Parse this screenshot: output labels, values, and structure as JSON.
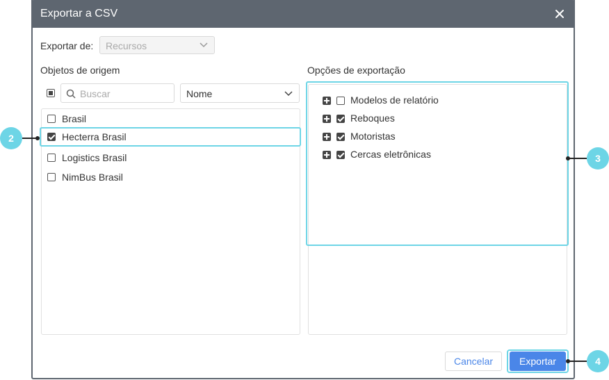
{
  "dialog": {
    "title": "Exportar a CSV",
    "export_from_label": "Exportar de:",
    "export_from_value": "Recursos"
  },
  "source": {
    "title": "Objetos de origem",
    "search_placeholder": "Buscar",
    "sort_value": "Nome",
    "items": [
      {
        "label": "Brasil",
        "checked": false
      },
      {
        "label": "Hecterra Brasil",
        "checked": true
      },
      {
        "label": "Logistics Brasil",
        "checked": false
      },
      {
        "label": "NimBus Brasil",
        "checked": false
      }
    ]
  },
  "options": {
    "title": "Opções de exportação",
    "items": [
      {
        "label": "Modelos de relatório",
        "checked": false
      },
      {
        "label": "Reboques",
        "checked": true
      },
      {
        "label": "Motoristas",
        "checked": true
      },
      {
        "label": "Cercas eletrônicas",
        "checked": true
      }
    ]
  },
  "buttons": {
    "cancel": "Cancelar",
    "export": "Exportar"
  },
  "callouts": [
    "2",
    "3",
    "4"
  ],
  "colors": {
    "titlebar": "#5e6670",
    "accent": "#4a86e8",
    "callout": "#6dd5e6"
  }
}
